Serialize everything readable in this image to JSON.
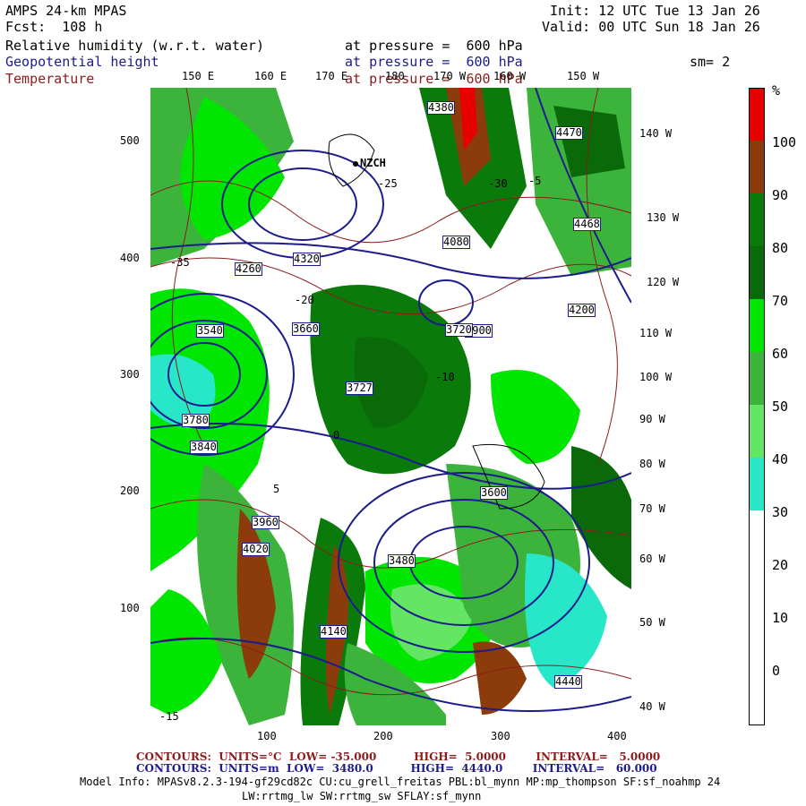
{
  "header": {
    "model": "AMPS 24-km MPAS",
    "fcst": "Fcst:  108 h",
    "init": "Init: 12 UTC Tue 13 Jan 26",
    "valid": "Valid: 00 UTC Sun 18 Jan 26",
    "fields": [
      {
        "name": "Relative humidity (w.r.t. water)",
        "level": "at pressure =  600 hPa",
        "color": "#000000"
      },
      {
        "name": "Geopotential height",
        "level": "at pressure =  600 hPa",
        "color": "#1c1c8c"
      },
      {
        "name": "Temperature",
        "level": "at pressure =  600 hPa",
        "color": "#8c1c1c"
      }
    ],
    "smoothing": "sm= 2"
  },
  "map": {
    "top_lon_labels": [
      "150 E",
      "160 E",
      "170 E",
      "180",
      "170 W",
      "160 W",
      "150 W"
    ],
    "right_lon_labels": [
      "140 W",
      "130 W",
      "120 W",
      "110 W",
      "100 W",
      "90 W",
      "80 W",
      "70 W",
      "60 W",
      "50 W",
      "40 W"
    ],
    "y_ticks": [
      "500",
      "400",
      "300",
      "200",
      "100"
    ],
    "x_ticks": [
      "100",
      "200",
      "300",
      "400"
    ],
    "station_label": "NZCH",
    "height_labels": [
      "4380",
      "4320",
      "4260",
      "4200",
      "4140",
      "4080",
      "4020",
      "3960",
      "3900",
      "3840",
      "3780",
      "3727",
      "3720",
      "3660",
      "3600",
      "3540",
      "3480",
      "4468",
      "4470",
      "4440"
    ],
    "temp_labels": [
      "-35",
      "-30",
      "-25",
      "-20",
      "-15",
      "-10",
      "-5",
      "0",
      "5"
    ]
  },
  "colorbar": {
    "unit": "%",
    "labels": [
      "100",
      "90",
      "80",
      "70",
      "60",
      "50",
      "40",
      "30",
      "20",
      "10",
      "0"
    ],
    "segments": [
      {
        "from": 100,
        "color": "#e60000"
      },
      {
        "from": 90,
        "color": "#8b3c0a"
      },
      {
        "from": 80,
        "color": "#0a7a0a"
      },
      {
        "from": 70,
        "color": "#0a6a0a"
      },
      {
        "from": 60,
        "color": "#00e600"
      },
      {
        "from": 50,
        "color": "#3cb43c"
      },
      {
        "from": 40,
        "color": "#64e664"
      },
      {
        "from": 30,
        "color": "#28e6c8"
      },
      {
        "from": 20,
        "color": "#ffffff"
      },
      {
        "from": 10,
        "color": "#ffffff"
      },
      {
        "from": 0,
        "color": "#ffffff"
      }
    ]
  },
  "footer": {
    "temp_contours": "CONTOURS:  UNITS=°C  LOW= -35.000          HIGH=  5.0000        INTERVAL=   5.0000",
    "height_contours": "CONTOURS:  UNITS=m  LOW=  3480.0          HIGH=  4440.0        INTERVAL=   60.000",
    "model_info": "Model Info: MPASv8.2.3-194-gf29cd82c CU:cu_grell_freitas PBL:bl_mynn MP:mp_thompson SF:sf_noahmp 24",
    "model_info2": "LW:rrtmg_lw SW:rrtmg_sw SFLAY:sf_mynn"
  }
}
